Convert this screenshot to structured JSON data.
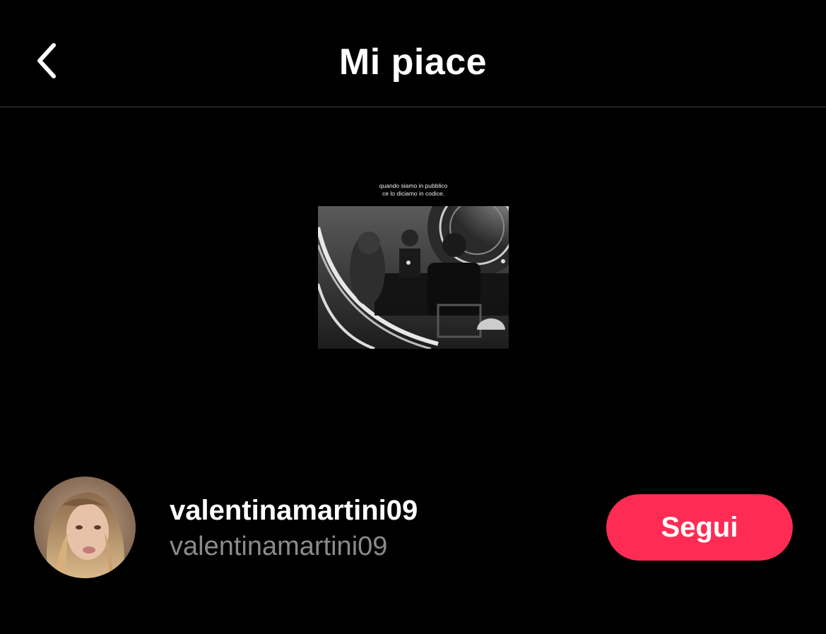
{
  "header": {
    "title": "Mi piace",
    "back_icon": "chevron-left-icon"
  },
  "video": {
    "caption_line1": "quando siamo in pubblico",
    "caption_line2": "ce lo diciamo in codice."
  },
  "user": {
    "username": "valentinamartini09",
    "handle": "valentinamartini09",
    "follow_label": "Segui"
  },
  "colors": {
    "background": "#000000",
    "accent": "#fe2c55",
    "secondary_text": "#8a8a8a",
    "divider": "#3a3a3a"
  }
}
